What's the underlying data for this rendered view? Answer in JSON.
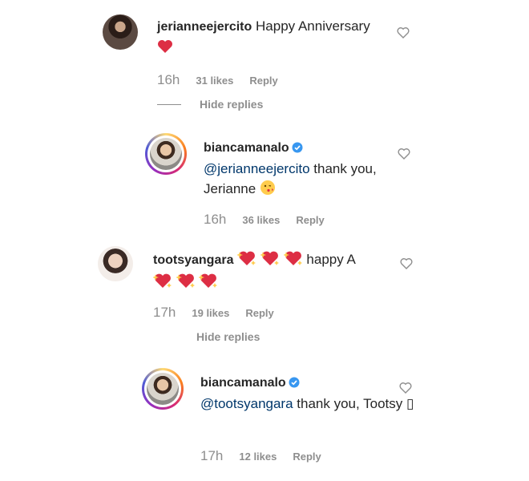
{
  "comments": [
    {
      "username": "jerianneejercito",
      "text_before": "Happy Anniversary",
      "time": "16h",
      "likes": "31 likes",
      "reply": "Reply",
      "hide_replies": "Hide replies"
    },
    {
      "username": "biancamanalo",
      "mention": "@jerianneejercito",
      "text": "thank you, Jerianne",
      "time": "16h",
      "likes": "36 likes",
      "reply": "Reply"
    },
    {
      "username": "tootsyangara",
      "text": "happy A",
      "time": "17h",
      "likes": "19 likes",
      "reply": "Reply",
      "hide_replies": "Hide replies"
    },
    {
      "username": "biancamanalo",
      "mention": "@tootsyangara",
      "text": "thank you, Tootsy ▯",
      "time": "17h",
      "likes": "12 likes",
      "reply": "Reply"
    }
  ],
  "colors": {
    "text": "#262626",
    "muted": "#8e8e8e",
    "mention": "#00376b",
    "verified": "#3897f0",
    "heart": "#ed1c24"
  },
  "icons": [
    "heart-emoji-icon",
    "sparkling-heart-emoji-icon",
    "kiss-emoji-icon",
    "verified-badge-icon",
    "like-heart-icon"
  ]
}
